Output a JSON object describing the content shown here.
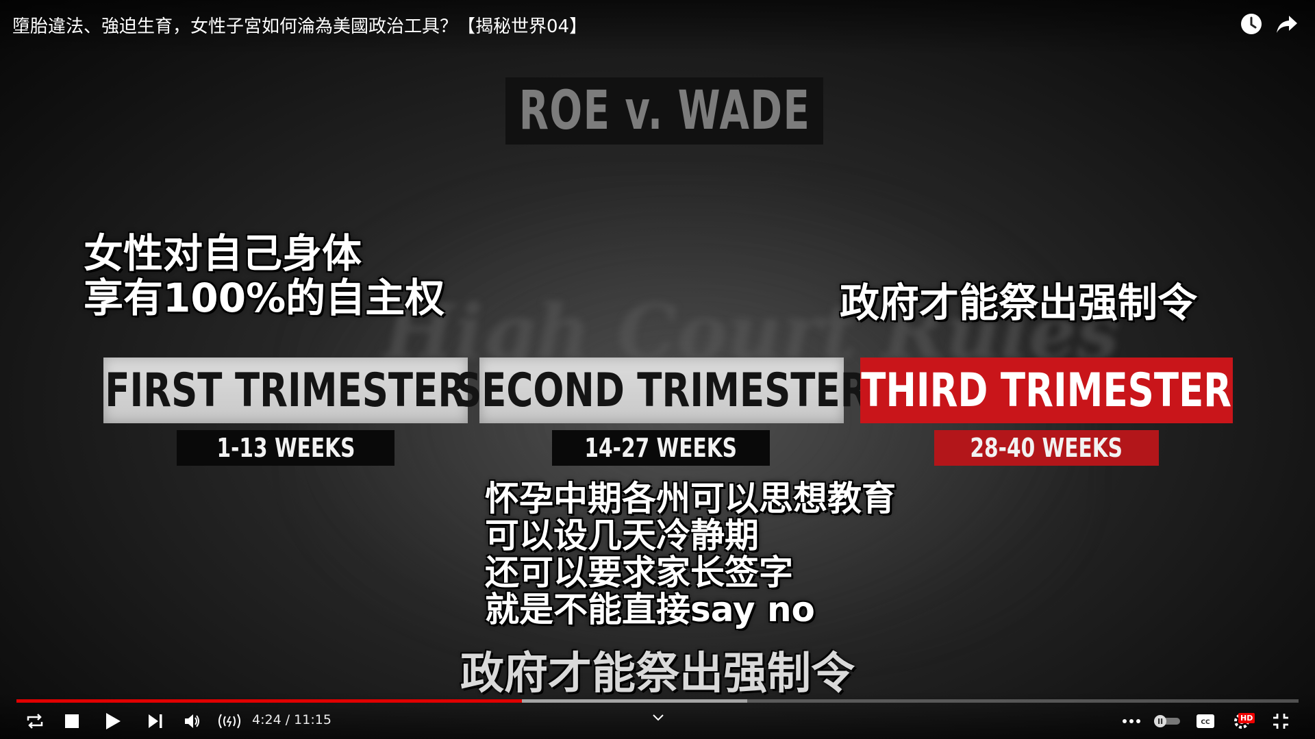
{
  "video": {
    "title": "墮胎違法、強迫生育，女性子宮如何淪為美國政治工具？【揭秘世界04】"
  },
  "top_actions": {
    "watch_later_icon": "clock-icon",
    "share_icon": "share-arrow-icon"
  },
  "frame": {
    "case_title": "ROE v. WADE",
    "background_headline": "High Court Rules",
    "trimesters": [
      {
        "label": "FIRST TRIMESTER",
        "weeks": "1-13 WEEKS",
        "color": "#d4d4d4"
      },
      {
        "label": "SECOND TRIMESTER",
        "weeks": "14-27 WEEKS",
        "color": "#d4d4d4"
      },
      {
        "label": "THIRD TRIMESTER",
        "weeks": "28-40 WEEKS",
        "color": "#c9151a"
      }
    ],
    "caption_left": [
      "女性对自己身体",
      "享有100%的自主权"
    ],
    "caption_right": "政府才能祭出强制令",
    "caption_middle": [
      "怀孕中期各州可以思想教育",
      "可以设几天冷静期",
      "还可以要求家长签字",
      "就是不能直接say no"
    ]
  },
  "subtitle": "政府才能祭出强制令",
  "player": {
    "current_time": "4:24",
    "separator": " / ",
    "duration": "11:15",
    "played_fraction": 0.394,
    "buffered_fraction": 0.57,
    "progress_color": "#e00000",
    "hd_badge": "HD",
    "icons": [
      "loop-icon",
      "stop-icon",
      "play-icon",
      "next-icon",
      "volume-icon",
      "live-broadcast-icon",
      "chevron-down-icon",
      "more-icon",
      "autoplay-toggle-icon",
      "captions-icon",
      "settings-icon",
      "exit-fullscreen-icon"
    ]
  }
}
